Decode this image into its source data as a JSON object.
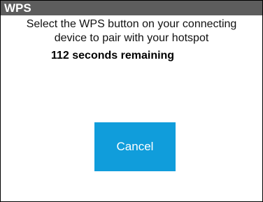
{
  "dialog": {
    "title": "WPS",
    "message": "Select the WPS button on your connecting device to pair with your hotspot",
    "countdown": "112 seconds remaining",
    "cancel_label": "Cancel"
  },
  "colors": {
    "titlebar": "#5d5d5d",
    "button": "#109ddb"
  }
}
